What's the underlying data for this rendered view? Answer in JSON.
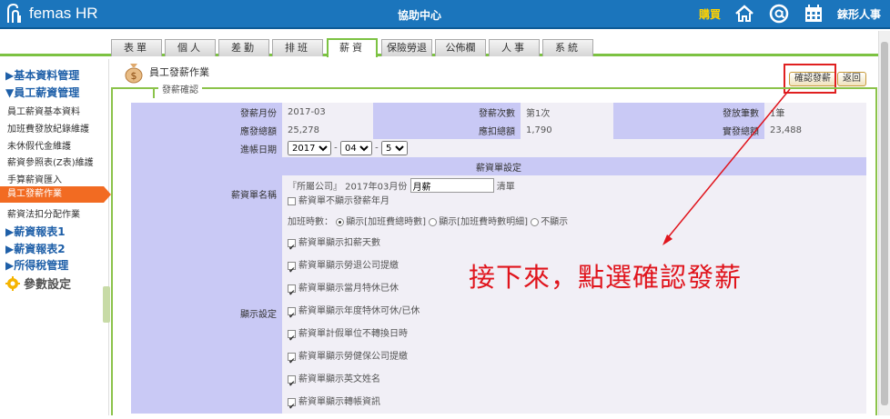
{
  "header": {
    "brand": "femas HR",
    "center_title": "協助中心",
    "buy_label": "購買",
    "user_name": "錸形人事"
  },
  "tabs": [
    {
      "label": "表單"
    },
    {
      "label": "個人"
    },
    {
      "label": "差勤"
    },
    {
      "label": "排班"
    },
    {
      "label": "薪資",
      "active": true
    },
    {
      "label": "保險勞退"
    },
    {
      "label": "公佈欄"
    },
    {
      "label": "人事"
    },
    {
      "label": "系統"
    }
  ],
  "sidebar": {
    "group1": "▶基本資料管理",
    "group2": "▼員工薪資管理",
    "items": [
      "員工薪資基本資料",
      "加班費發放紀錄維護",
      "未休假代金維護",
      "薪資參照表(Z表)維護",
      "手算薪資匯入",
      "員工發薪作業",
      "薪資法扣分配作業"
    ],
    "active_item": "員工發薪作業",
    "group3": "▶薪資報表1",
    "group4": "▶薪資報表2",
    "group5": "▶所得稅管理",
    "param": "參數設定"
  },
  "page": {
    "title": "員工發薪作業",
    "legend": "發薪確認",
    "confirm_button": "確認發薪",
    "back_button": "返回"
  },
  "summary": {
    "month_label": "發薪月份",
    "month_value": "2017-03",
    "times_label": "發薪次數",
    "times_value": "第1次",
    "count_label": "發放筆數",
    "count_value": "1筆",
    "gross_label": "應發總額",
    "gross_value": "25,278",
    "deduct_label": "應扣總額",
    "deduct_value": "1,790",
    "net_label": "實發總額",
    "net_value": "23,488",
    "date_label": "進帳日期",
    "date_year": "2017",
    "date_month": "04",
    "date_day": "5"
  },
  "settings": {
    "section_title": "薪資單設定",
    "name_label": "薪資單名稱",
    "name_prefix": "『所屬公司』 2017年03月份",
    "name_input": "月薪",
    "name_suffix": "清單",
    "hide_month_option": "薪資單不顯示發薪年月",
    "display_label": "顯示設定",
    "ot_hours_label": "加班時數：",
    "ot_opt1": "顯示[加班費總時數]",
    "ot_opt2": "顯示[加班費時數明細]",
    "ot_opt3": "不顯示",
    "options": [
      "薪資單顯示扣薪天數",
      "薪資單顯示勞退公司提繳",
      "薪資單顯示當月特休已休",
      "薪資單顯示年度特休可休/已休",
      "薪資單計假單位不轉換日時",
      "薪資單顯示勞健保公司提繳",
      "薪資單顯示英文姓名",
      "薪資單顯示轉帳資訊"
    ]
  },
  "annotation": "接下來，點選確認發薪",
  "colors": {
    "header_blue": "#1b75bc",
    "tab_green": "#7cc242",
    "active_orange": "#f26b22",
    "label_purple": "#c9c9f5",
    "annotation_red": "#e0141c"
  }
}
